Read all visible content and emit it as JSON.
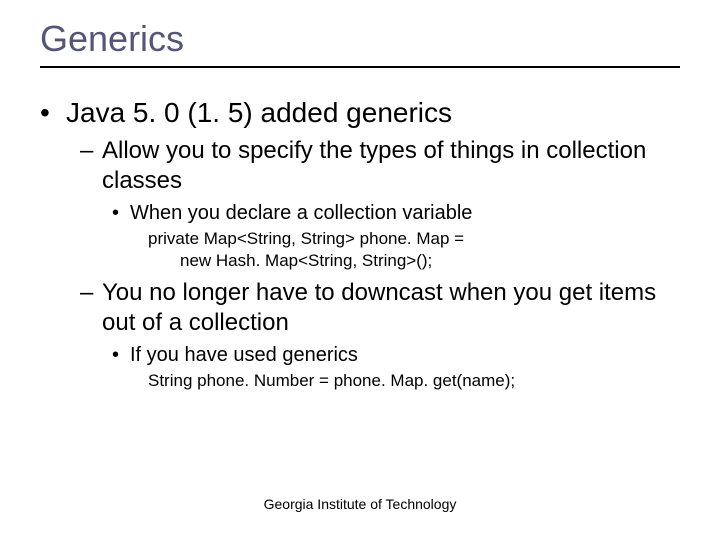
{
  "title": "Generics",
  "body": {
    "item1": "Java 5. 0 (1. 5) added generics",
    "item1_sub1": "Allow you to specify the types of things in collection classes",
    "item1_sub1_sub1": "When you declare a collection variable",
    "code1_line1": "private Map<String, String> phone. Map =",
    "code1_line2": "new Hash. Map<String, String>();",
    "item1_sub2": "You no longer have to downcast when you get items out of a collection",
    "item1_sub2_sub1": "If you have used generics",
    "code2_line1": "String phone. Number = phone. Map. get(name);"
  },
  "footer": "Georgia Institute of Technology"
}
